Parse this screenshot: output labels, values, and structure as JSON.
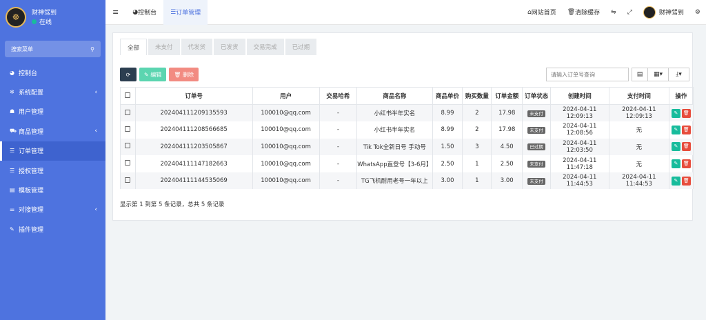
{
  "sidebar": {
    "username": "财神驾到",
    "status": "在线",
    "search_label": "搜索菜单",
    "items": [
      {
        "label": "控制台",
        "icon": "dashboard-icon",
        "glyph": "◕",
        "chev": ""
      },
      {
        "label": "系统配置",
        "icon": "gear-icon",
        "glyph": "✲",
        "chev": "‹"
      },
      {
        "label": "用户管理",
        "icon": "user-icon",
        "glyph": "☗",
        "chev": ""
      },
      {
        "label": "商品管理",
        "icon": "cart-icon",
        "glyph": "⛟",
        "chev": "‹"
      },
      {
        "label": "订单管理",
        "icon": "list-icon",
        "glyph": "☰",
        "chev": ""
      },
      {
        "label": "授权管理",
        "icon": "list-icon",
        "glyph": "☰",
        "chev": ""
      },
      {
        "label": "模板管理",
        "icon": "template-icon",
        "glyph": "▤",
        "chev": ""
      },
      {
        "label": "对接管理",
        "icon": "sliders-icon",
        "glyph": "⚌",
        "chev": "‹"
      },
      {
        "label": "插件管理",
        "icon": "plug-icon",
        "glyph": "✎",
        "chev": ""
      }
    ],
    "active_index": 4
  },
  "topbar": {
    "tabs": [
      {
        "label": "控制台",
        "glyph": "◕"
      },
      {
        "label": "订单管理",
        "glyph": "☰"
      }
    ],
    "right": [
      {
        "label": "网站首页",
        "glyph": "⌂"
      },
      {
        "label": "清除缓存",
        "glyph": "🗑"
      },
      {
        "label": "",
        "glyph": "⇋"
      },
      {
        "label": "",
        "glyph": "⤢"
      },
      {
        "label": "财神驾到",
        "glyph": ""
      },
      {
        "label": "",
        "glyph": "⚙"
      }
    ]
  },
  "status_tabs": [
    "全部",
    "未支付",
    "代发货",
    "已发货",
    "交易完成",
    "已过期"
  ],
  "toolbar": {
    "edit": "编辑",
    "delete": "删除",
    "search_placeholder": "请输入订单号查询"
  },
  "table": {
    "headers": [
      "订单号",
      "用户",
      "交易哈希",
      "商品名称",
      "商品单价",
      "购买数量",
      "订单金额",
      "订单状态",
      "创建时间",
      "支付时间",
      "操作"
    ],
    "rows": [
      [
        "202404111209135593",
        "100010@qq.com",
        "-",
        "小红书半年实名",
        "8.99",
        "2",
        "17.98",
        "未支付",
        "2024-04-11 12:09:13",
        "2024-04-11 12:09:13"
      ],
      [
        "202404111208566685",
        "100010@qq.com",
        "-",
        "小红书半年实名",
        "8.99",
        "2",
        "17.98",
        "未支付",
        "2024-04-11 12:08:56",
        "无"
      ],
      [
        "202404111203505867",
        "100010@qq.com",
        "-",
        "Tik Tok全新日号 手动号",
        "1.50",
        "3",
        "4.50",
        "已过期",
        "2024-04-11 12:03:50",
        "无"
      ],
      [
        "202404111147182663",
        "100010@qq.com",
        "-",
        "WhatsApp直登号【3-6月】",
        "2.50",
        "1",
        "2.50",
        "未支付",
        "2024-04-11 11:47:18",
        "无"
      ],
      [
        "202404111144535069",
        "100010@qq.com",
        "-",
        "TG飞机耐用老号一年以上",
        "3.00",
        "1",
        "3.00",
        "未支付",
        "2024-04-11 11:44:53",
        "2024-04-11 11:44:53"
      ]
    ]
  },
  "footer_text": "显示第 1 到第 5 条记录，总共 5 条记录"
}
